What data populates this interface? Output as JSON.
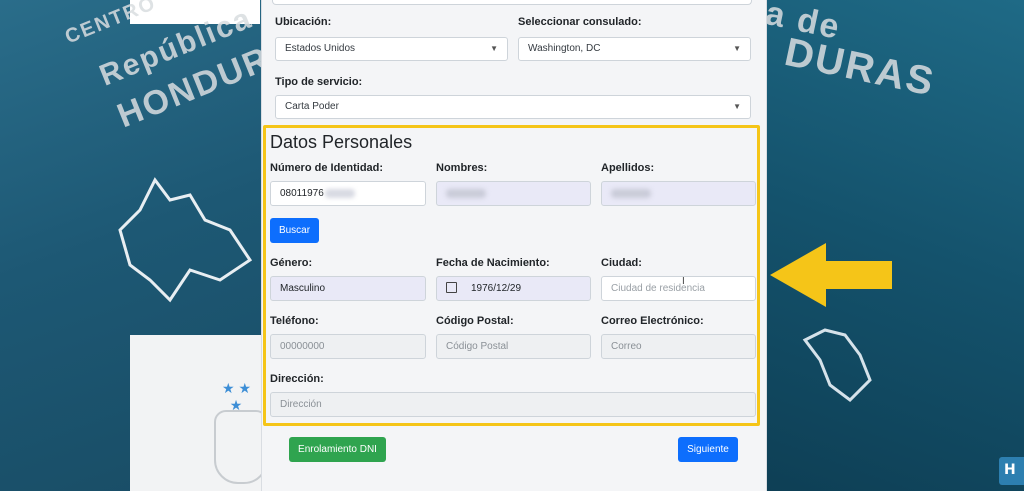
{
  "form": {
    "ubicacion": {
      "label": "Ubicación:",
      "value": "Estados Unidos"
    },
    "consulado": {
      "label": "Seleccionar consulado:",
      "value": "Washington, DC"
    },
    "tipo_servicio": {
      "label": "Tipo de servicio:",
      "value": "Carta Poder"
    }
  },
  "datos_personales": {
    "title": "Datos Personales",
    "numero_identidad": {
      "label": "Número de Identidad:",
      "value": "08011976"
    },
    "nombres": {
      "label": "Nombres:"
    },
    "apellidos": {
      "label": "Apellidos:"
    },
    "buscar_label": "Buscar",
    "genero": {
      "label": "Género:",
      "value": "Masculino"
    },
    "fecha_nacimiento": {
      "label": "Fecha de Nacimiento:",
      "value": "1976/12/29"
    },
    "ciudad": {
      "label": "Ciudad:",
      "placeholder": "Ciudad de residencia"
    },
    "telefono": {
      "label": "Teléfono:",
      "placeholder": "00000000"
    },
    "codigo_postal": {
      "label": "Código Postal:",
      "placeholder": "Código Postal"
    },
    "correo": {
      "label": "Correo Electrónico:",
      "placeholder": "Correo"
    },
    "direccion": {
      "label": "Dirección:",
      "placeholder": "Dirección"
    }
  },
  "actions": {
    "enrolamiento_label": "Enrolamiento DNI",
    "siguiente_label": "Siguiente"
  },
  "background": {
    "left_line1": "CENTRO",
    "left_line2": "República",
    "left_line3": "HONDURAS",
    "right_line1": "a de",
    "right_line2": "DURAS"
  },
  "colors": {
    "highlight": "#f5c518",
    "primary_button": "#0d6efd",
    "success_button": "#2fa44f"
  },
  "icons": [
    "caret-down-icon",
    "calendar-icon",
    "arrow-left-icon",
    "text-cursor-icon",
    "star-icon"
  ]
}
